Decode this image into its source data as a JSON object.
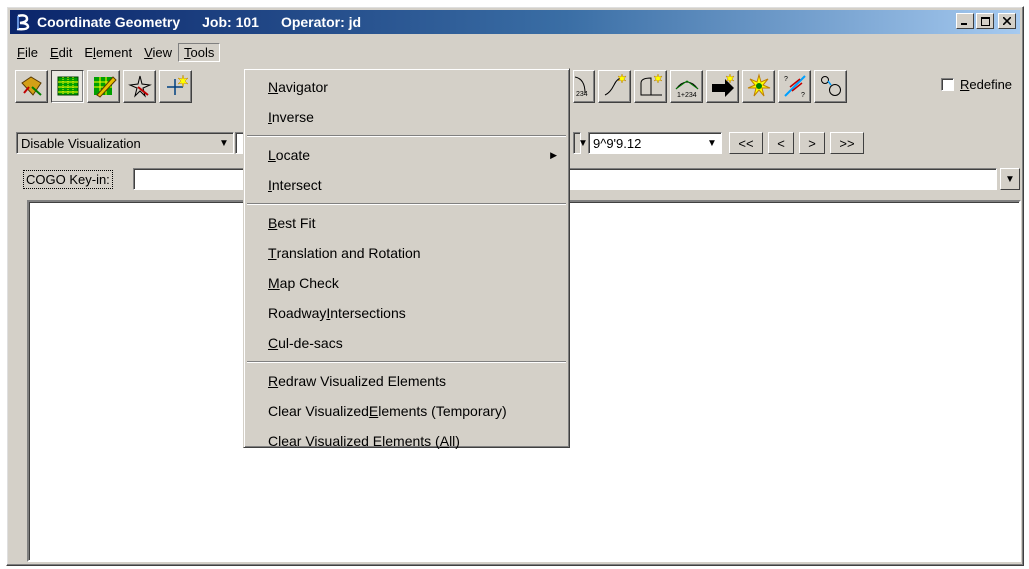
{
  "window": {
    "title_app": "Coordinate Geometry",
    "title_job": "Job: 101",
    "title_operator": "Operator: jd"
  },
  "menubar": [
    {
      "pre": "",
      "mnem": "F",
      "post": "ile"
    },
    {
      "pre": "",
      "mnem": "E",
      "post": "dit"
    },
    {
      "pre": "E",
      "mnem": "l",
      "post": "ement"
    },
    {
      "pre": "",
      "mnem": "V",
      "post": "iew"
    },
    {
      "pre": "",
      "mnem": "T",
      "post": "ools"
    }
  ],
  "toolbar": {
    "redefine_pre": "",
    "redefine_mnem": "R",
    "redefine_post": "edefine"
  },
  "controls": {
    "visualization_value": "Disable Visualization",
    "angle_value": "9^9'9.12",
    "nav_first": "<<",
    "nav_prev": "<",
    "nav_next": ">",
    "nav_last": ">>"
  },
  "keyin": {
    "label": "COGO Key-in:",
    "value": ""
  },
  "tools_menu": {
    "navigator": {
      "pre": "",
      "mnem": "N",
      "post": "avigator"
    },
    "inverse": {
      "pre": "",
      "mnem": "I",
      "post": "nverse"
    },
    "locate": {
      "pre": "",
      "mnem": "L",
      "post": "ocate"
    },
    "intersect": {
      "pre": "",
      "mnem": "I",
      "post": "ntersect"
    },
    "best_fit": {
      "pre": "",
      "mnem": "B",
      "post": "est Fit"
    },
    "translation": {
      "pre": "",
      "mnem": "T",
      "post": "ranslation and Rotation"
    },
    "map_check": {
      "pre": "",
      "mnem": "M",
      "post": "ap Check"
    },
    "roadway": {
      "pre": "Roadway ",
      "mnem": "I",
      "post": "ntersections"
    },
    "culdesacs": {
      "pre": "",
      "mnem": "C",
      "post": "ul-de-sacs"
    },
    "redraw": {
      "pre": "",
      "mnem": "R",
      "post": "edraw Visualized Elements"
    },
    "clear_temp": {
      "pre": "Clear Visualized ",
      "mnem": "E",
      "post": "lements (Temporary)"
    },
    "clear_all": {
      "pre": "Clear Visualized Elements (",
      "mnem": "A",
      "post": "ll)"
    }
  },
  "colors": {
    "titlebar_start": "#0a246a",
    "titlebar_end": "#a6caf0",
    "face": "#d4d0c8"
  }
}
